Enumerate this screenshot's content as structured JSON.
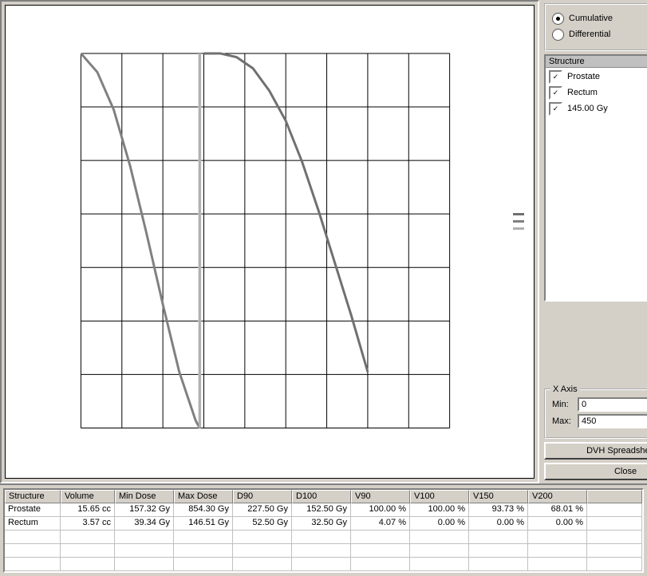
{
  "radio": {
    "cumulative": "Cumulative",
    "differential": "Differential",
    "selected": "cumulative"
  },
  "structure": {
    "title": "Structure",
    "items": [
      {
        "label": "Prostate",
        "checked": true
      },
      {
        "label": "Rectum",
        "checked": true
      },
      {
        "label": "145.00 Gy",
        "checked": true
      }
    ]
  },
  "xaxis": {
    "title": "X Axis",
    "min_label": "Min:",
    "max_label": "Max:",
    "min": "0",
    "max": "450"
  },
  "buttons": {
    "spreadsheet": "DVH Spreadsheet...",
    "close": "Close"
  },
  "table": {
    "columns": [
      "Structure",
      "Volume",
      "Min Dose",
      "Max Dose",
      "D90",
      "D100",
      "V90",
      "V100",
      "V150",
      "V200"
    ],
    "rows": [
      [
        "Prostate",
        "15.65 cc",
        "157.32 Gy",
        "854.30 Gy",
        "227.50 Gy",
        "152.50 Gy",
        "100.00 %",
        "100.00 %",
        "93.73 %",
        "68.01 %"
      ],
      [
        "Rectum",
        "3.57 cc",
        "39.34 Gy",
        "146.51 Gy",
        "52.50 Gy",
        "32.50 Gy",
        "4.07 %",
        "0.00 %",
        "0.00 %",
        "0.00 %"
      ]
    ]
  },
  "chart_data": {
    "type": "line",
    "title": "",
    "xlabel": "",
    "ylabel": "",
    "xlim": [
      0,
      450
    ],
    "ylim": [
      0,
      100
    ],
    "reference_line_x": 145,
    "series": [
      {
        "name": "Prostate",
        "color": "#707070",
        "x": [
          150,
          170,
          190,
          210,
          230,
          250,
          270,
          290,
          310,
          330,
          350
        ],
        "y": [
          100,
          100,
          99,
          96,
          90,
          82,
          71,
          58,
          44,
          30,
          15
        ]
      },
      {
        "name": "Rectum",
        "color": "#808080",
        "x": [
          0,
          20,
          40,
          60,
          80,
          100,
          120,
          140,
          145
        ],
        "y": [
          100,
          95,
          85,
          70,
          52,
          33,
          15,
          2,
          0
        ]
      },
      {
        "name": "145.00 Gy",
        "color": "#b0b0b0",
        "x": [
          145,
          145
        ],
        "y": [
          0,
          100
        ]
      }
    ]
  },
  "legend_colors": [
    "#707070",
    "#808080",
    "#b0b0b0"
  ]
}
